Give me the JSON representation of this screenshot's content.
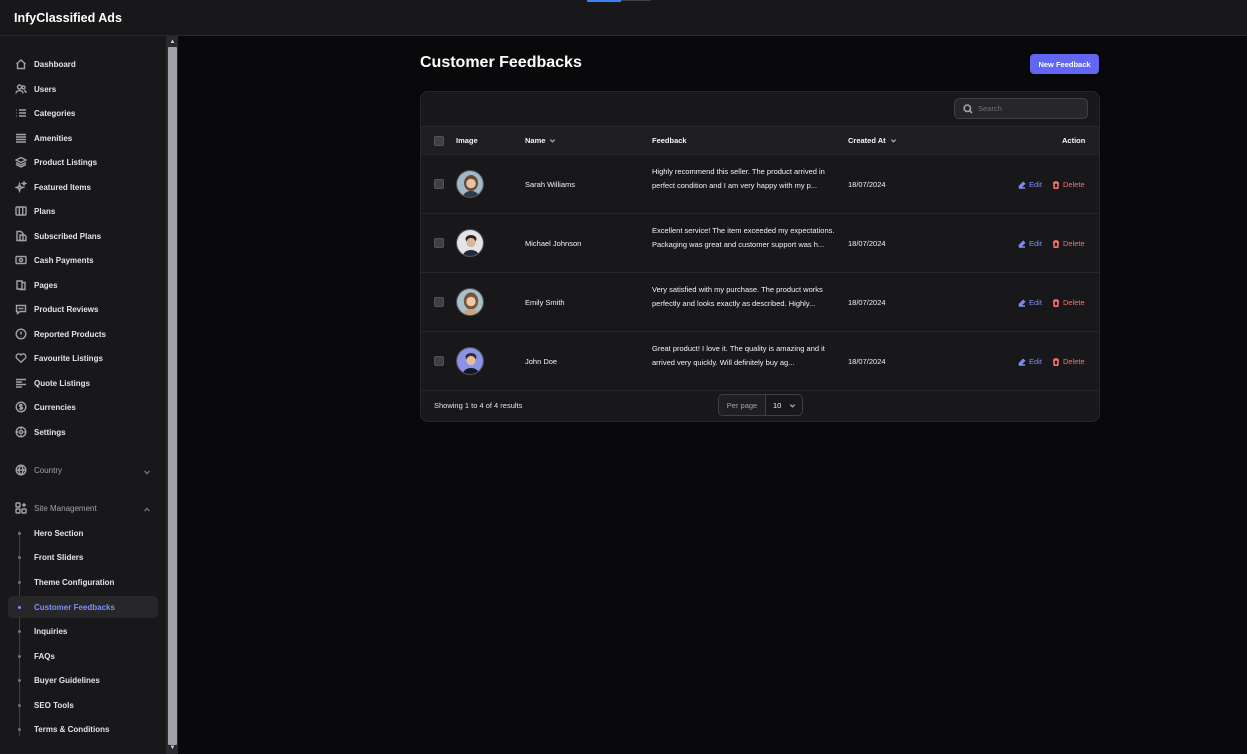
{
  "app": {
    "title": "InfyClassified Ads"
  },
  "sidebar": {
    "items": [
      {
        "label": "Dashboard",
        "icon": "home-icon"
      },
      {
        "label": "Users",
        "icon": "users-icon"
      },
      {
        "label": "Categories",
        "icon": "list-icon"
      },
      {
        "label": "Amenities",
        "icon": "menu-lines-icon"
      },
      {
        "label": "Product Listings",
        "icon": "layers-icon"
      },
      {
        "label": "Featured Items",
        "icon": "sparkles-icon"
      },
      {
        "label": "Plans",
        "icon": "columns-icon"
      },
      {
        "label": "Subscribed Plans",
        "icon": "document-stack-icon"
      },
      {
        "label": "Cash Payments",
        "icon": "banknote-icon"
      },
      {
        "label": "Pages",
        "icon": "pages-icon"
      },
      {
        "label": "Product Reviews",
        "icon": "chat-bubble-icon"
      },
      {
        "label": "Reported Products",
        "icon": "alert-circle-icon"
      },
      {
        "label": "Favourite Listings",
        "icon": "heart-icon"
      },
      {
        "label": "Quote Listings",
        "icon": "align-left-icon"
      },
      {
        "label": "Currencies",
        "icon": "currency-dollar-icon"
      },
      {
        "label": "Settings",
        "icon": "cog-icon"
      }
    ],
    "country": {
      "label": "Country",
      "icon": "globe-icon"
    },
    "site_management": {
      "label": "Site Management",
      "icon": "squares-plus-icon",
      "children": [
        "Hero Section",
        "Front Sliders",
        "Theme Configuration",
        "Customer Feedbacks",
        "Inquiries",
        "FAQs",
        "Buyer Guidelines",
        "SEO Tools",
        "Terms & Conditions"
      ],
      "active": "Customer Feedbacks"
    }
  },
  "main": {
    "title": "Customer Feedbacks",
    "new_button": "New Feedback",
    "search_placeholder": "Search",
    "columns": {
      "image": "Image",
      "name": "Name",
      "feedback": "Feedback",
      "created_at": "Created At",
      "action": "Action"
    },
    "rows": [
      {
        "name": "Sarah Williams",
        "feedback": "Highly recommend this seller. The product arrived in perfect condition and I am very happy with my p...",
        "created_at": "18/07/2024",
        "edit": "Edit",
        "delete": "Delete"
      },
      {
        "name": "Michael Johnson",
        "feedback": "Excellent service! The item exceeded my expectations. Packaging was great and customer support was h...",
        "created_at": "18/07/2024",
        "edit": "Edit",
        "delete": "Delete"
      },
      {
        "name": "Emily Smith",
        "feedback": "Very satisfied with my purchase. The product works perfectly and looks exactly as described. Highly...",
        "created_at": "18/07/2024",
        "edit": "Edit",
        "delete": "Delete"
      },
      {
        "name": "John Doe",
        "feedback": "Great product! I love it. The quality is amazing and it arrived very quickly. Will definitely buy ag...",
        "created_at": "18/07/2024",
        "edit": "Edit",
        "delete": "Delete"
      }
    ],
    "footer": {
      "summary": "Showing 1 to 4 of 4 results",
      "per_page_label": "Per page",
      "per_page_value": "10"
    }
  },
  "colors": {
    "accent": "#6366f1",
    "link": "#818cf8",
    "danger": "#f87171",
    "background": "#09090b",
    "panel": "#18181b"
  }
}
